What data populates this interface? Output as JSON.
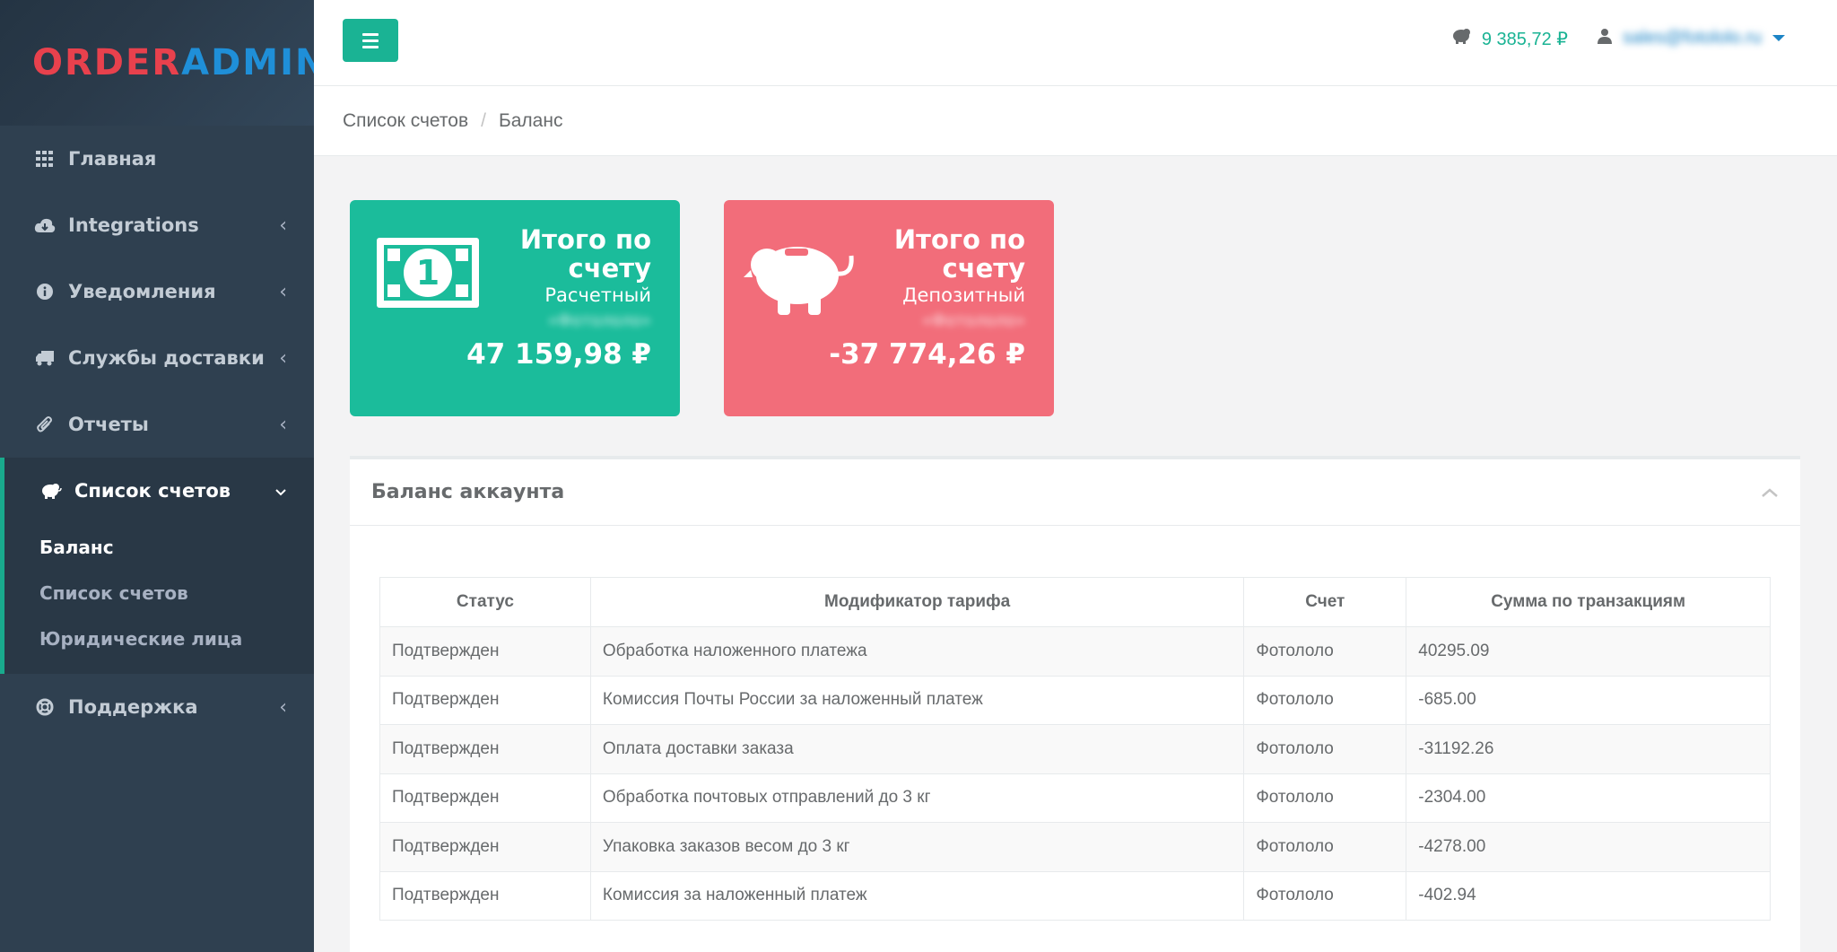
{
  "brand": {
    "part1": "ORDER",
    "part2": "ADMIN"
  },
  "sidebar": {
    "items": [
      {
        "label": "Главная",
        "icon": "grid-icon"
      },
      {
        "label": "Integrations",
        "icon": "cloud-download-icon"
      },
      {
        "label": "Уведомления",
        "icon": "info-circle-icon"
      },
      {
        "label": "Службы доставки",
        "icon": "truck-icon"
      },
      {
        "label": "Отчеты",
        "icon": "paperclip-icon"
      },
      {
        "label": "Список счетов",
        "icon": "piggy-bank-icon"
      },
      {
        "label": "Поддержка",
        "icon": "life-ring-icon"
      }
    ],
    "submenu": [
      {
        "label": "Баланс"
      },
      {
        "label": "Список счетов"
      },
      {
        "label": "Юридические лица"
      }
    ]
  },
  "topbar": {
    "balance": "9 385,72 ₽",
    "user_email": "sales@fotololo.ru"
  },
  "breadcrumb": {
    "parent": "Список счетов",
    "current": "Баланс",
    "separator": "/"
  },
  "widgets": [
    {
      "title": "Итого по счету",
      "type": "Расчетный",
      "owner": "«Фотололо»",
      "value": "47 159,98 ₽",
      "color": "#1bbc9b"
    },
    {
      "title": "Итого по счету",
      "type": "Депозитный",
      "owner": "«Фотололо»",
      "value": "-37 774,26 ₽",
      "color": "#f26d7a"
    }
  ],
  "panel": {
    "title": "Баланс аккаунта",
    "columns": [
      "Статус",
      "Модификатор тарифа",
      "Счет",
      "Сумма по транзакциям"
    ],
    "rows": [
      [
        "Подтвержден",
        "Обработка наложенного платежа",
        "Фотололо",
        "40295.09"
      ],
      [
        "Подтвержден",
        "Комиссия Почты России за наложенный платеж",
        "Фотололо",
        "-685.00"
      ],
      [
        "Подтвержден",
        "Оплата доставки заказа",
        "Фотололо",
        "-31192.26"
      ],
      [
        "Подтвержден",
        "Обработка почтовых отправлений до 3 кг",
        "Фотололо",
        "-2304.00"
      ],
      [
        "Подтвержден",
        "Упаковка заказов весом до 3 кг",
        "Фотололо",
        "-4278.00"
      ],
      [
        "Подтвержден",
        "Комиссия за наложенный платеж",
        "Фотололо",
        "-402.94"
      ]
    ]
  },
  "colors": {
    "accent": "#1ab394",
    "sidebar": "#2f4050",
    "danger": "#f26d7a"
  }
}
